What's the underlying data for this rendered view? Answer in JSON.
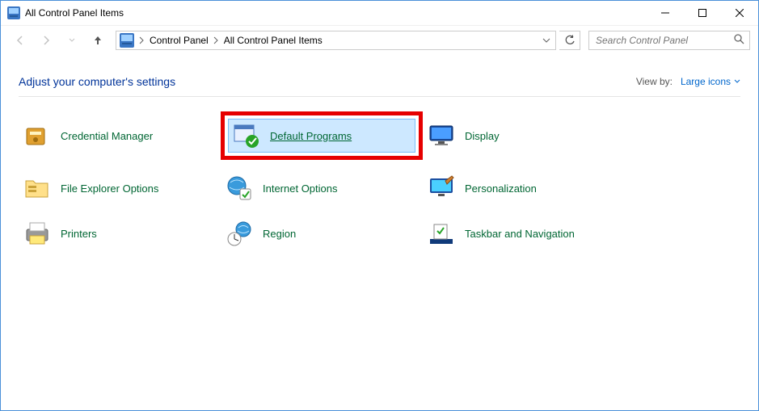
{
  "window": {
    "title": "All Control Panel Items"
  },
  "breadcrumbs": {
    "a": "Control Panel",
    "b": "All Control Panel Items"
  },
  "search": {
    "placeholder": "Search Control Panel"
  },
  "header": {
    "heading": "Adjust your computer's settings"
  },
  "viewby": {
    "label": "View by:",
    "value": "Large icons"
  },
  "items": {
    "credential_manager": "Credential Manager",
    "default_programs": "Default Programs",
    "display": "Display",
    "file_explorer_options": "File Explorer Options",
    "internet_options": "Internet Options",
    "personalization": "Personalization",
    "printers": "Printers",
    "region": "Region",
    "taskbar_navigation": "Taskbar and Navigation"
  }
}
